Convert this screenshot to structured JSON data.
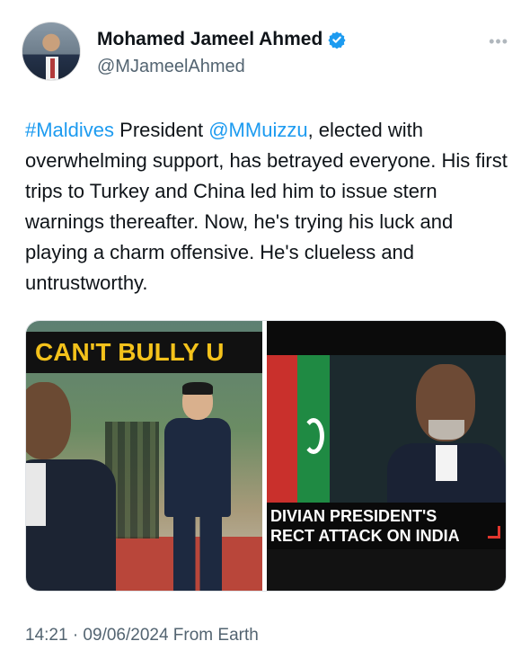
{
  "author": {
    "display_name": "Mohamed Jameel Ahmed",
    "handle": "@MJameelAhmed",
    "verified": true
  },
  "tweet": {
    "hashtag": "#Maldives",
    "text_1": " President ",
    "mention": "@MMuizzu",
    "text_2": ", elected with overwhelming support, has betrayed everyone. His first trips to Turkey and China led him to issue stern warnings thereafter. Now, he's trying his luck and playing a charm offensive. He's clueless and untrustworthy."
  },
  "media": {
    "left_banner": "CAN'T BULLY U",
    "right_caption_line1": "DIVIAN PRESIDENT'S",
    "right_caption_line2": "RECT ATTACK ON INDIA"
  },
  "meta": {
    "timestamp": "14:21 · 09/06/2024 From Earth"
  },
  "colors": {
    "link": "#1d9bf0",
    "banner_text": "#f4c21b",
    "secondary_text": "#536471"
  }
}
